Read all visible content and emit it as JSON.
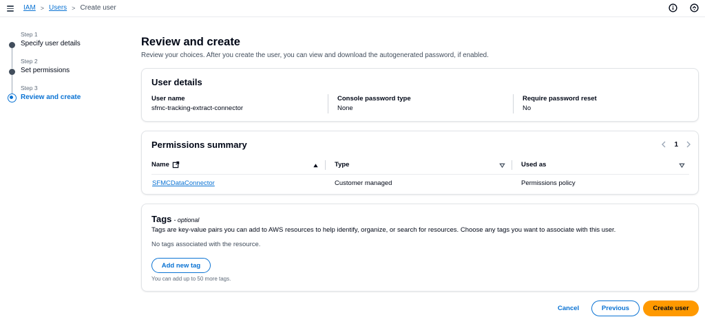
{
  "breadcrumb": {
    "items": [
      "IAM",
      "Users"
    ],
    "current": "Create user"
  },
  "stepper": {
    "steps": [
      {
        "num": "Step 1",
        "label": "Specify user details"
      },
      {
        "num": "Step 2",
        "label": "Set permissions"
      },
      {
        "num": "Step 3",
        "label": "Review and create"
      }
    ]
  },
  "page": {
    "title": "Review and create",
    "description": "Review your choices. After you create the user, you can view and download the autogenerated password, if enabled."
  },
  "user_details": {
    "title": "User details",
    "fields": [
      {
        "label": "User name",
        "value": "sfmc-tracking-extract-connector"
      },
      {
        "label": "Console password type",
        "value": "None"
      },
      {
        "label": "Require password reset",
        "value": "No"
      }
    ]
  },
  "permissions": {
    "title": "Permissions summary",
    "page_number": "1",
    "columns": [
      "Name",
      "Type",
      "Used as"
    ],
    "rows": [
      {
        "name": "SFMCDataConnector",
        "type": "Customer managed",
        "used_as": "Permissions policy"
      }
    ]
  },
  "tags": {
    "title": "Tags",
    "optional": "- optional",
    "description": "Tags are key-value pairs you can add to AWS resources to help identify, organize, or search for resources. Choose any tags you want to associate with this user.",
    "empty": "No tags associated with the resource.",
    "add_button": "Add new tag",
    "hint": "You can add up to 50 more tags."
  },
  "footer": {
    "cancel": "Cancel",
    "previous": "Previous",
    "create": "Create user"
  },
  "colors": {
    "link": "#0972d3",
    "primary": "#ff9900",
    "text": "#000716"
  },
  "icons": [
    "menu-icon",
    "info-icon",
    "notification-icon",
    "external-link-icon",
    "sort-up-icon",
    "sort-down-icon",
    "chevron-left-icon",
    "chevron-right-icon"
  ]
}
